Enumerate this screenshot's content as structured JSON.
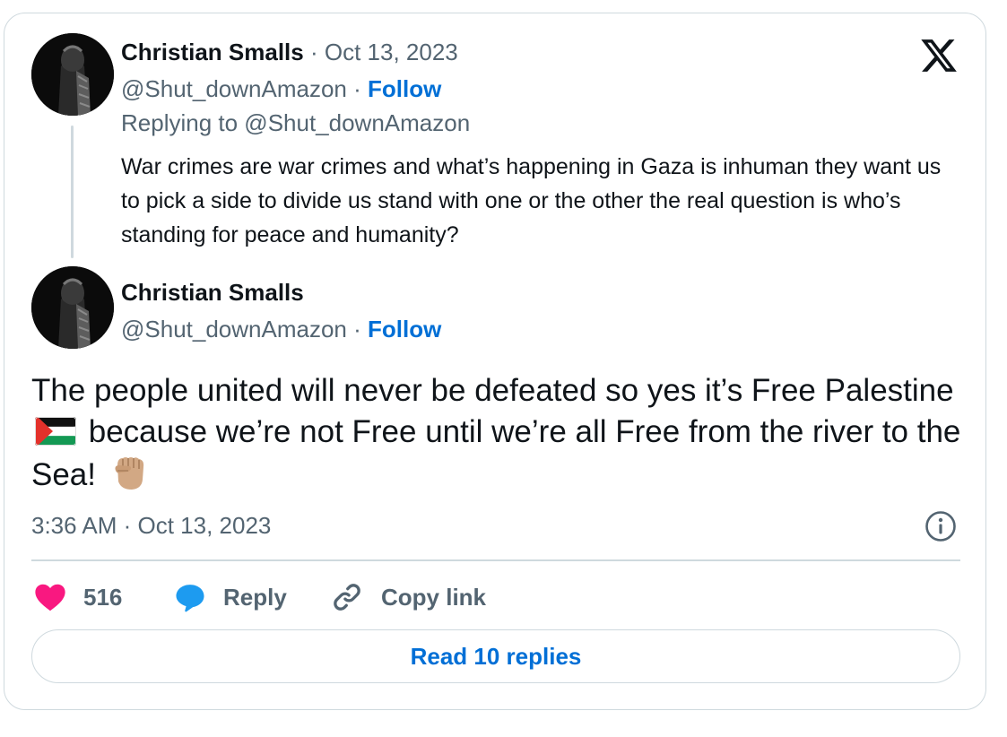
{
  "quoted_tweet": {
    "author_name": "Christian Smalls",
    "date": "Oct 13, 2023",
    "handle": "@Shut_downAmazon",
    "follow_label": "Follow",
    "replying_to": "Replying to @Shut_downAmazon",
    "text": "War crimes are war crimes and what’s happening in Gaza is inhuman they want us to pick a side to divide us stand with one or the other the real question is who’s standing for peace and humanity?"
  },
  "tweet": {
    "author_name": "Christian Smalls",
    "handle": "@Shut_downAmazon",
    "follow_label": "Follow",
    "text_part1": "The people united will never be defeated so yes it’s Free Palestine",
    "text_part2": "because we’re not Free until we’re all Free from the river to the Sea!",
    "emoji_flag": "palestine-flag",
    "emoji_fist": "raised-fist-medium-light-skin",
    "timestamp": "3:36 AM · Oct 13, 2023"
  },
  "actions": {
    "like_count": "516",
    "reply_label": "Reply",
    "copy_link_label": "Copy link"
  },
  "read_replies_label": "Read 10 replies",
  "separator": "·",
  "icons": {
    "brand": "x-logo-icon",
    "info": "info-icon",
    "like": "heart-icon",
    "reply": "reply-bubble-icon",
    "copy": "link-icon"
  },
  "colors": {
    "text": "#0f1419",
    "muted": "#536471",
    "link": "#006fd6",
    "like": "#f91880",
    "reply": "#1d9bf0",
    "border": "#cfd9de"
  }
}
